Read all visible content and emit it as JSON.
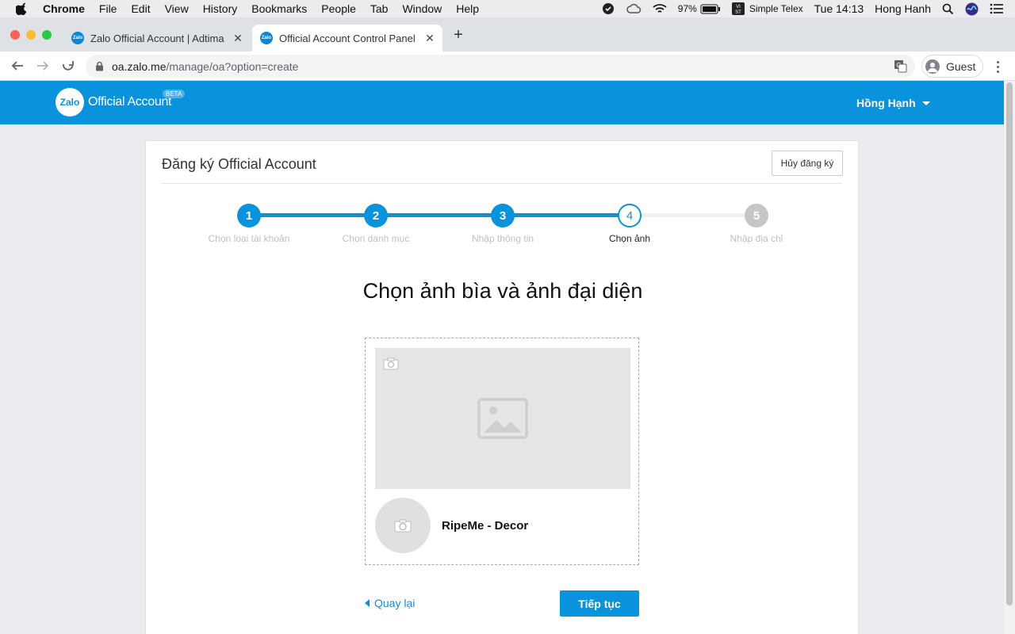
{
  "menubar": {
    "app": "Chrome",
    "items": [
      "File",
      "Edit",
      "View",
      "History",
      "Bookmarks",
      "People",
      "Tab",
      "Window",
      "Help"
    ],
    "battery": "97%",
    "input_method": "Simple Telex",
    "clock": "Tue 14:13",
    "user": "Hong Hanh"
  },
  "tabs": [
    {
      "title": "Zalo Official Account | Adtima",
      "active": false
    },
    {
      "title": "Official Account Control Panel",
      "active": true
    }
  ],
  "address": {
    "host": "oa.zalo.me",
    "path": "/manage/oa?option=create"
  },
  "profile": {
    "label": "Guest"
  },
  "header": {
    "logo_text": "Zalo",
    "product": "Official Account",
    "badge": "BETA",
    "user": "Hồng Hạnh"
  },
  "card": {
    "title": "Đăng ký Official Account",
    "cancel_label": "Hủy đăng ký",
    "steps": [
      {
        "number": "1",
        "label": "Chọn loại tài khoản",
        "status": "done"
      },
      {
        "number": "2",
        "label": "Chọn danh mục",
        "status": "done"
      },
      {
        "number": "3",
        "label": "Nhập thông tin",
        "status": "done"
      },
      {
        "number": "4",
        "label": "Chọn ảnh",
        "status": "current"
      },
      {
        "number": "5",
        "label": "Nhập địa chỉ",
        "status": "todo"
      }
    ],
    "heading": "Chọn ảnh bìa và ảnh đại diện",
    "oa_name": "RipeMe - Decor",
    "back_label": "Quay lại",
    "next_label": "Tiếp tục"
  },
  "colors": {
    "brand": "#0893dc",
    "inactive_step": "#c6c6c6",
    "track_inactive": "#f0f0f0"
  }
}
